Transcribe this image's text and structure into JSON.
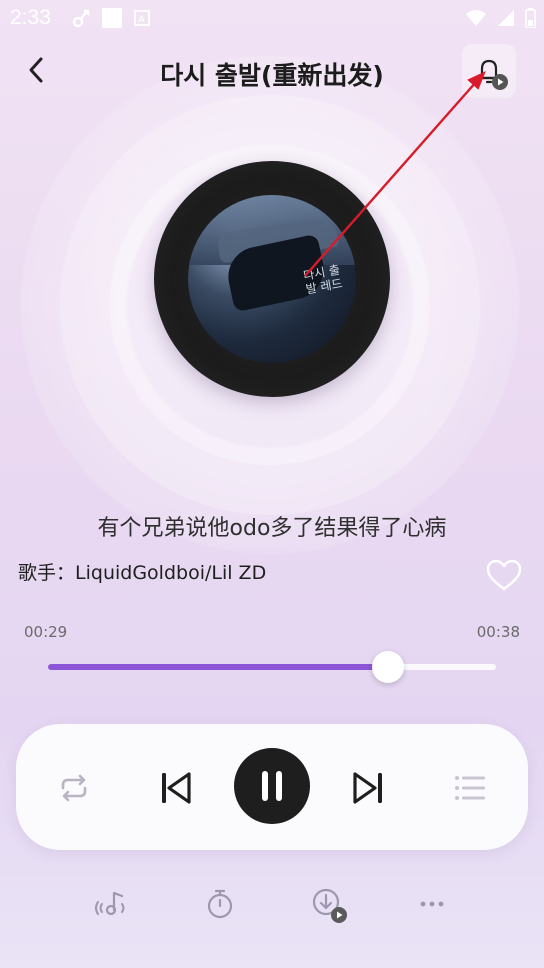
{
  "status": {
    "time": "2:33",
    "icons_left": [
      "link-icon",
      "square-icon",
      "a-badge-icon"
    ],
    "icons_right": [
      "wifi-icon",
      "signal-icon",
      "battery-icon"
    ]
  },
  "header": {
    "title": "다시 출발(重新出发)",
    "back_icon": "chevron-left-icon",
    "ringtone_icon": "bell-play-icon"
  },
  "album": {
    "art_text": "다시 출발 레드"
  },
  "lyric": "有个兄弟说他odo多了结果得了心病",
  "singer": {
    "prefix": "歌手：",
    "name": "LiquidGoldboi/Lil ZD"
  },
  "progress": {
    "current": "00:29",
    "total": "00:38",
    "fraction": 0.76
  },
  "colors": {
    "accent": "#8d56d8",
    "annotation_arrow": "#d81b2a"
  },
  "controls": {
    "loop_icon": "repeat-icon",
    "prev_icon": "skip-previous-icon",
    "play_state_icon": "pause-icon",
    "next_icon": "skip-next-icon",
    "list_icon": "playlist-icon"
  },
  "bottom": {
    "icons": [
      "music-vibrate-icon",
      "timer-icon",
      "download-play-icon",
      "more-icon"
    ]
  }
}
